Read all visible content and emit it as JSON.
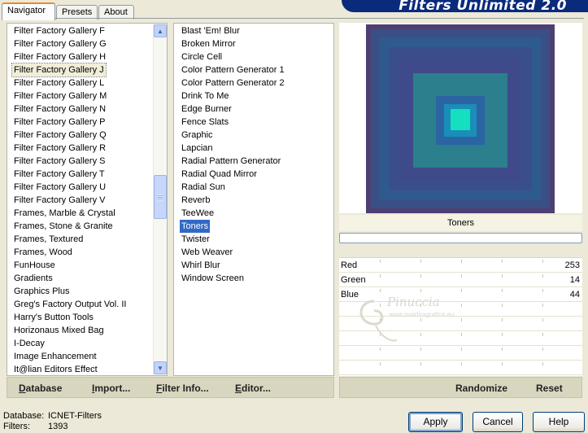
{
  "tabs": [
    "Navigator",
    "Presets",
    "About"
  ],
  "banner_title": "Filters Unlimited 2.0",
  "categories": [
    "Filter Factory Gallery F",
    "Filter Factory Gallery G",
    "Filter Factory Gallery H",
    "Filter Factory Gallery J",
    "Filter Factory Gallery L",
    "Filter Factory Gallery M",
    "Filter Factory Gallery N",
    "Filter Factory Gallery P",
    "Filter Factory Gallery Q",
    "Filter Factory Gallery R",
    "Filter Factory Gallery S",
    "Filter Factory Gallery T",
    "Filter Factory Gallery U",
    "Filter Factory Gallery V",
    "Frames, Marble & Crystal",
    "Frames, Stone & Granite",
    "Frames, Textured",
    "Frames, Wood",
    "FunHouse",
    "Gradients",
    "Graphics Plus",
    "Greg's Factory Output Vol. II",
    "Harry's Button Tools",
    "Horizonaus Mixed Bag",
    "I-Decay",
    "Image Enhancement",
    "It@lian Editors Effect"
  ],
  "selected_category": "Filter Factory Gallery J",
  "filters": [
    "Blast 'Em! Blur",
    "Broken Mirror",
    "Circle Cell",
    "Color Pattern Generator 1",
    "Color Pattern Generator 2",
    "Drink To Me",
    "Edge Burner",
    "Fence Slats",
    "Graphic",
    "Lapcian",
    "Radial Pattern Generator",
    "Radial Quad Mirror",
    "Radial Sun",
    "Reverb",
    "TeeWee",
    "Toners",
    "Twister",
    "Web Weaver",
    "Whirl Blur",
    "Window Screen"
  ],
  "selected_filter": "Toners",
  "preview_filter_name": "Toners",
  "progress": 0,
  "parameters": [
    {
      "label": "Red",
      "value": "253"
    },
    {
      "label": "Green",
      "value": "14"
    },
    {
      "label": "Blue",
      "value": "44"
    }
  ],
  "watermark": {
    "text": "Pinuccia",
    "url": "www.maidiragrafica.eu"
  },
  "left_toolbar": [
    {
      "label": "Database",
      "hot": "D"
    },
    {
      "label": "Import...",
      "hot": "I"
    },
    {
      "label": "Filter Info...",
      "hot": "F"
    },
    {
      "label": "Editor...",
      "hot": "E"
    }
  ],
  "right_toolbar": {
    "randomize": "Randomize",
    "reset": "Reset"
  },
  "status": {
    "database_label": "Database:",
    "database_value": "ICNET-Filters",
    "filters_label": "Filters:",
    "filters_value": "1393"
  },
  "buttons": {
    "apply": "Apply",
    "cancel": "Cancel",
    "help": "Help"
  },
  "colors": {
    "selection": "#316ac5",
    "banner": "#0a2a7c",
    "tab_accent": "#e68b2c"
  },
  "icons": {
    "scroll_up": "triangle-up",
    "scroll_down": "triangle-down"
  }
}
